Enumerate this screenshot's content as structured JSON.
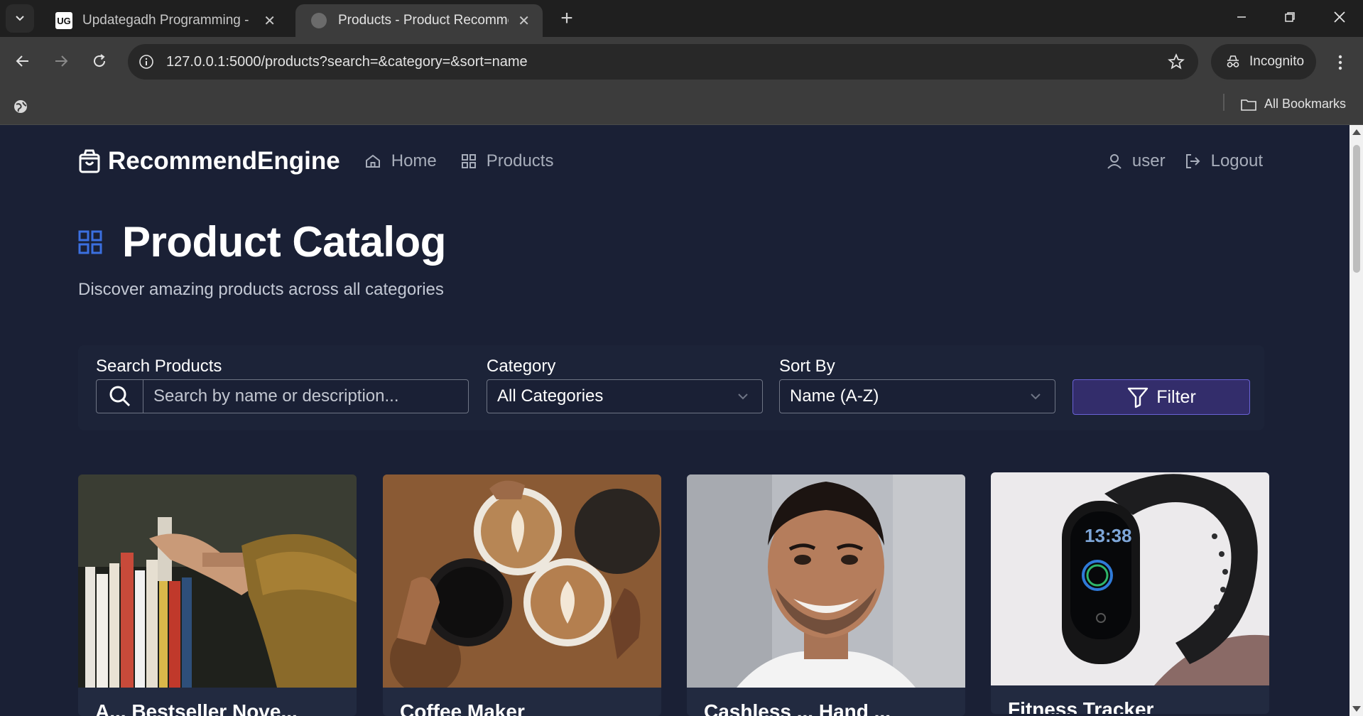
{
  "browser": {
    "tabs": [
      {
        "title": "Updategadh Programming - Up",
        "favicon": "UG",
        "active": false
      },
      {
        "title": "Products - Product Recommend",
        "favicon": "globe-icon",
        "active": true
      }
    ],
    "url": "127.0.0.1:5000/products?search=&category=&sort=name",
    "profile_label": "Incognito",
    "bookmarks_label": "All Bookmarks"
  },
  "nav": {
    "brand": "RecommendEngine",
    "links": [
      {
        "label": "Home",
        "icon": "home-icon"
      },
      {
        "label": "Products",
        "icon": "grid-icon"
      }
    ],
    "user_label": "user",
    "logout_label": "Logout"
  },
  "header": {
    "title": "Product Catalog",
    "subtitle": "Discover amazing products across all categories"
  },
  "filters": {
    "search_label": "Search Products",
    "search_placeholder": "Search by name or description...",
    "search_value": "",
    "category_label": "Category",
    "category_value": "All Categories",
    "sort_label": "Sort By",
    "sort_value": "Name (A-Z)",
    "filter_button": "Filter"
  },
  "products": [
    {
      "name": "A... Bestseller Nove...",
      "image": "books-on-shelf"
    },
    {
      "name": "Coffee Maker",
      "image": "coffee-cups"
    },
    {
      "name": "Cashless ... Hand ...",
      "image": "smiling-man"
    },
    {
      "name": "Fitness Tracker",
      "image": "fitness-band"
    }
  ],
  "colors": {
    "page_bg": "#1a2035",
    "accent": "#3b6fe0",
    "filter_button_bg": "#332d6b",
    "filter_button_border": "#6a62d6"
  }
}
